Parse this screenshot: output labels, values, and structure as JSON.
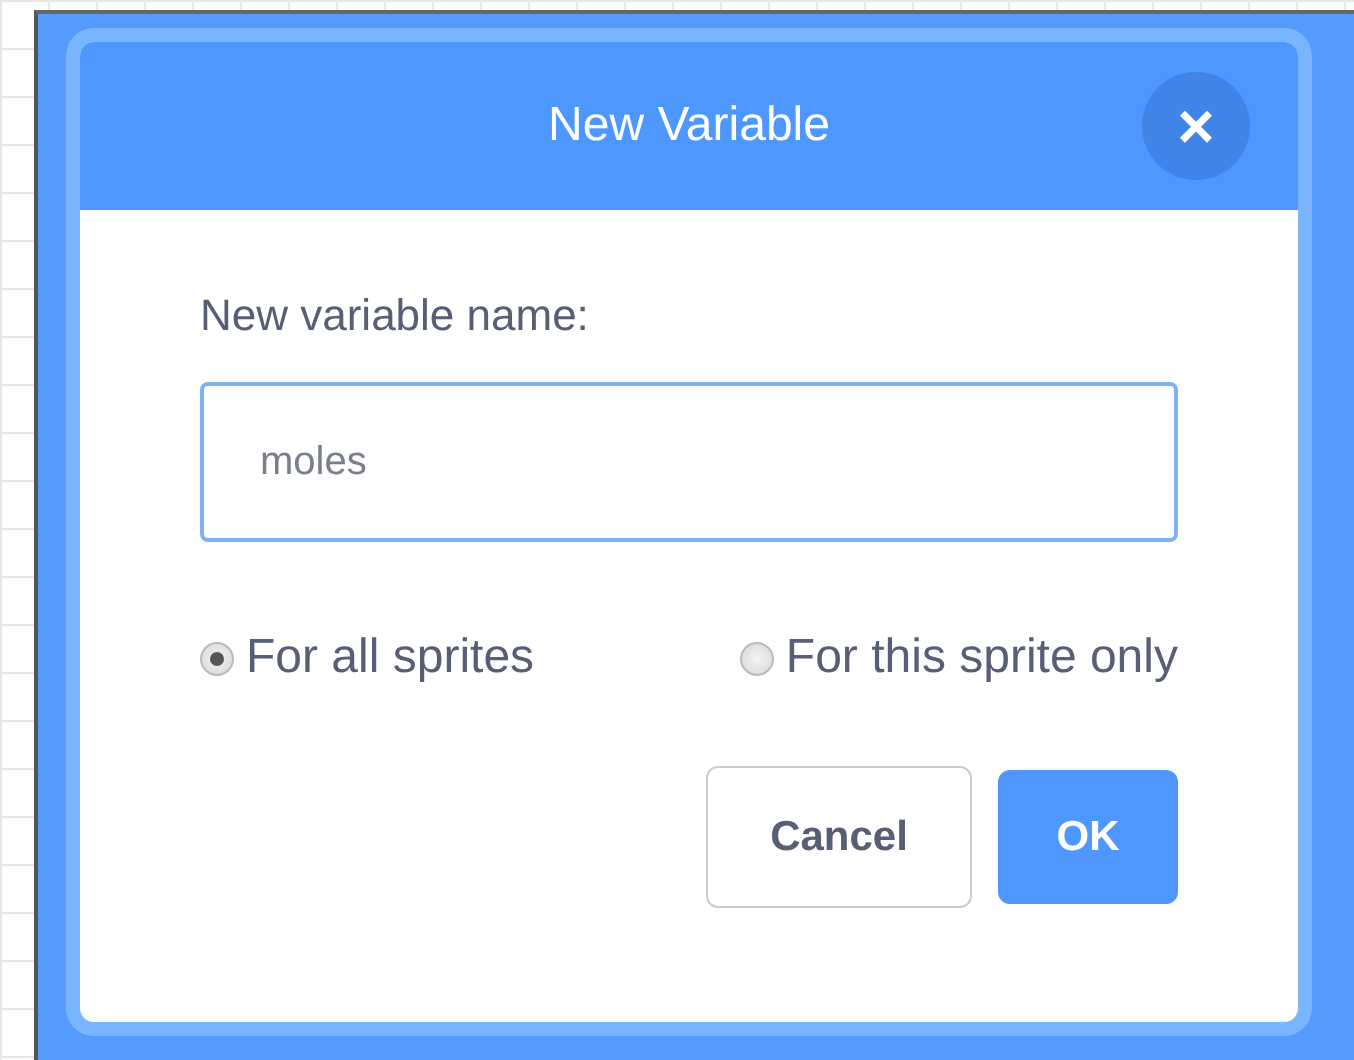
{
  "dialog": {
    "title": "New Variable",
    "close_label": "×",
    "prompt": "New variable name:",
    "input": {
      "value": "moles"
    },
    "scope_options": [
      {
        "label": "For all sprites",
        "selected": true
      },
      {
        "label": "For this sprite only",
        "selected": false
      }
    ],
    "buttons": [
      {
        "label": "Cancel",
        "kind": "secondary"
      },
      {
        "label": "OK",
        "kind": "primary"
      }
    ]
  }
}
